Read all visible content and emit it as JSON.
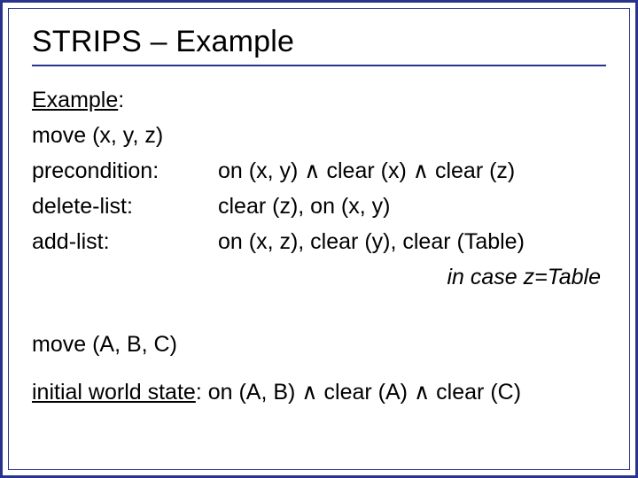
{
  "title": "STRIPS – Example",
  "example_label": "Example",
  "colon": ":",
  "operator": "move (x, y, z)",
  "rows": {
    "precondition": {
      "label": "precondition:",
      "value": "on (x, y) ∧ clear (x) ∧ clear (z)"
    },
    "delete": {
      "label": "delete-list:",
      "value": "clear (z), on (x, y)"
    },
    "add": {
      "label": "add-list:",
      "value": "on (x, z), clear (y), clear (Table)"
    }
  },
  "add_note": "in case z=Table",
  "instance": "move (A, B, C)",
  "initial_state": {
    "label": "initial world state",
    "value": ": on (A, B) ∧ clear (A) ∧ clear (C)"
  }
}
